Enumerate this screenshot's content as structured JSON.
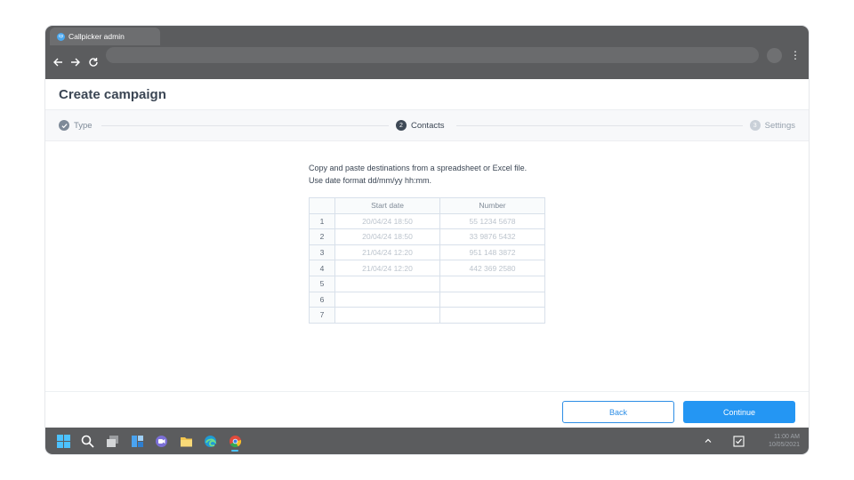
{
  "browser": {
    "tab_title": "Callpicker admin",
    "favicon_text": "cp",
    "back_icon": "arrow-left-icon",
    "forward_icon": "arrow-right-icon",
    "reload_icon": "reload-icon",
    "menu_icon": "more-vertical-icon"
  },
  "page": {
    "title": "Create campaign"
  },
  "steps": [
    {
      "number": "1",
      "label": "Type",
      "state": "done"
    },
    {
      "number": "2",
      "label": "Contacts",
      "state": "active"
    },
    {
      "number": "3",
      "label": "Settings",
      "state": "pending"
    }
  ],
  "instructions": {
    "line1": "Copy and paste destinations from a spreadsheet or Excel file.",
    "line2": "Use date format dd/mm/yy hh:mm."
  },
  "grid": {
    "headers": [
      "Start date",
      "Number"
    ],
    "rows": [
      {
        "n": "1",
        "date": "20/04/24 18:50",
        "number": "55 1234 5678"
      },
      {
        "n": "2",
        "date": "20/04/24 18:50",
        "number": "33 9876 5432"
      },
      {
        "n": "3",
        "date": "21/04/24 12:20",
        "number": "951 148 3872"
      },
      {
        "n": "4",
        "date": "21/04/24 12:20",
        "number": "442 369 2580"
      },
      {
        "n": "5",
        "date": "",
        "number": ""
      },
      {
        "n": "6",
        "date": "",
        "number": ""
      },
      {
        "n": "7",
        "date": "",
        "number": ""
      }
    ]
  },
  "buttons": {
    "back": "Back",
    "continue": "Continue"
  },
  "colors": {
    "accent": "#2496f3",
    "chrome": "#5b5c5e"
  },
  "taskbar": {
    "icons": [
      "windows-start-icon",
      "search-icon",
      "task-view-icon",
      "widgets-icon",
      "chat-icon",
      "file-explorer-icon",
      "edge-icon",
      "chrome-icon"
    ],
    "time": "11:00 AM",
    "date": "10/05/2021"
  }
}
